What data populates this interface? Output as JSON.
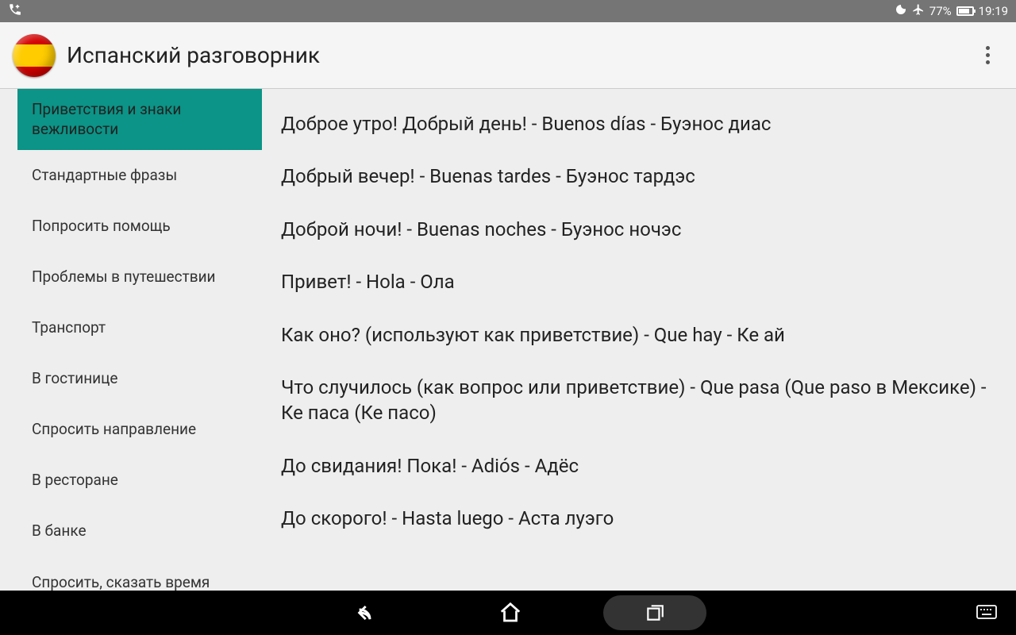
{
  "status": {
    "call_icon": "call-add-icon",
    "moon": "🌙",
    "plane": "✈",
    "battery_pct": "77%",
    "time": "19:19"
  },
  "app": {
    "title": "Испанский разговорник"
  },
  "sidebar": {
    "items": [
      {
        "label": "Приветствия и знаки вежливости",
        "active": true
      },
      {
        "label": "Стандартные фразы",
        "active": false
      },
      {
        "label": "Попросить помощь",
        "active": false
      },
      {
        "label": "Проблемы в путешествии",
        "active": false
      },
      {
        "label": "Транспорт",
        "active": false
      },
      {
        "label": "В гостинице",
        "active": false
      },
      {
        "label": "Спросить направление",
        "active": false
      },
      {
        "label": "В ресторане",
        "active": false
      },
      {
        "label": "В банке",
        "active": false
      },
      {
        "label": "Спросить, сказать время",
        "active": false
      }
    ]
  },
  "phrases": [
    "Доброе утро! Добрый день! - Buenos días - Буэнос диас",
    "Добрый вечер! - Buenas tardes - Буэнос тардэс",
    "Доброй ночи! - Buenas noches - Буэнос ночэс",
    "Привет! - Hola - Ола",
    "Как оно? (используют как приветствие) - Que hay - Ке ай",
    "Что случилось (как вопрос или приветствие) - Que pasa (Que paso в Мексике) - Ке паса (Ке пасо)",
    "До свидания! Пока! - Adiós - Адёс",
    "До скорого! - Hasta luego - Аста луэго"
  ]
}
